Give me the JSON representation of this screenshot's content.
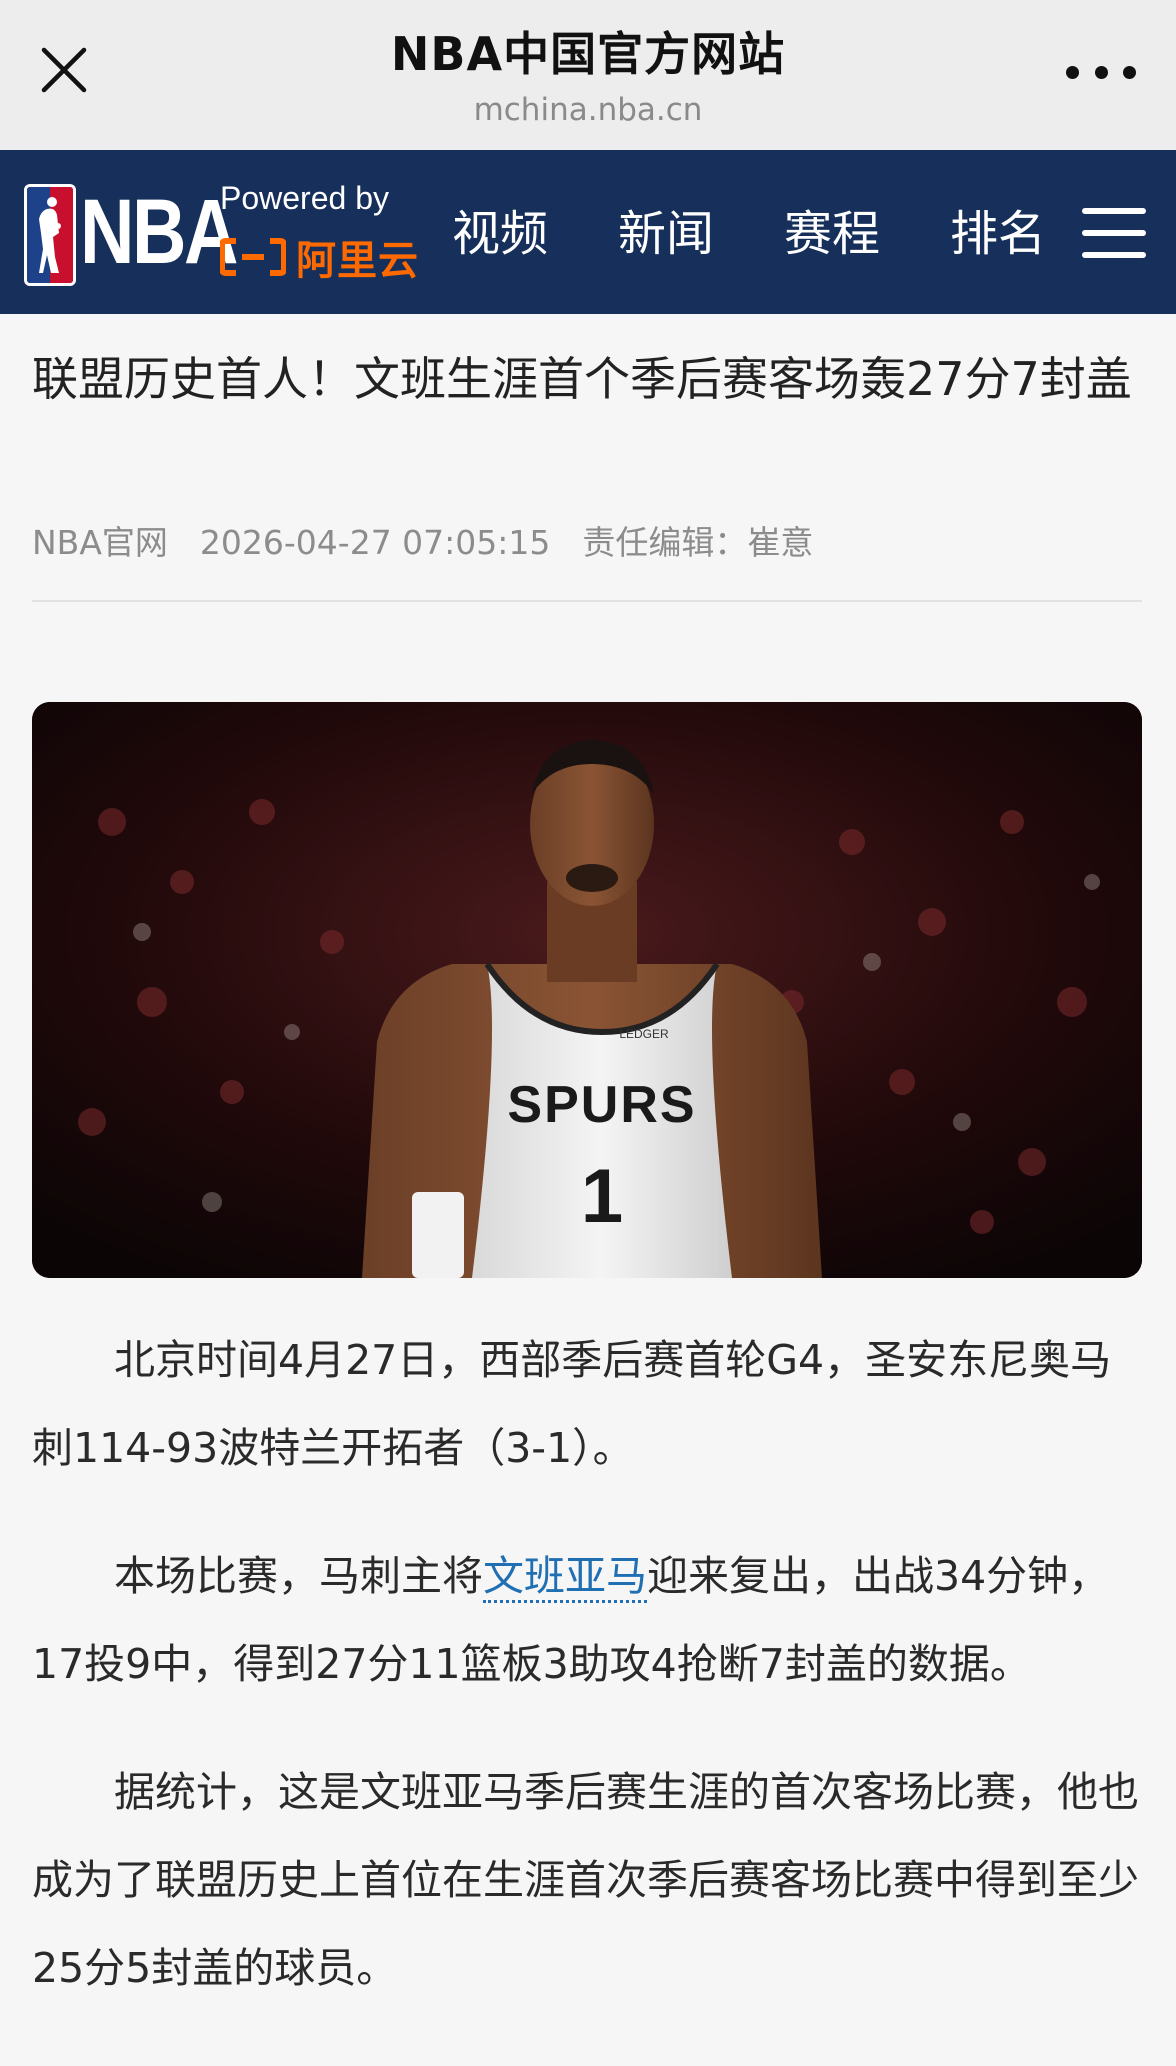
{
  "browser": {
    "title": "NBA中国官方网站",
    "url": "mchina.nba.cn",
    "close_icon": "close-icon",
    "more_icon": "more-icon"
  },
  "header": {
    "logo_text": "NBA",
    "powered_by": "Powered by",
    "sponsor": "阿里云",
    "nav": [
      "视频",
      "新闻",
      "赛程",
      "排名"
    ],
    "menu_icon": "hamburger-menu-icon",
    "colors": {
      "navy": "#17305b",
      "nba_blue": "#1d428a",
      "nba_red": "#c8102e",
      "aliyun_orange": "#ff6a00"
    }
  },
  "article": {
    "title": "联盟历史首人！文班生涯首个季后赛客场轰27分7封盖",
    "source": "NBA官网",
    "datetime": "2026-04-27 07:05:15",
    "editor": "责任编辑：崔意",
    "image": {
      "jersey_text": "SPURS",
      "jersey_number": "1",
      "sponsor_patch": "LEDGER"
    },
    "paragraphs": [
      {
        "text": "北京时间4月27日，西部季后赛首轮G4，圣安东尼奥马刺114-93波特兰开拓者（3-1）。"
      },
      {
        "before": "本场比赛，马刺主将",
        "link": "文班亚马",
        "after": "迎来复出，出战34分钟，17投9中，得到27分11篮板3助攻4抢断7封盖的数据。"
      },
      {
        "text": "据统计，这是文班亚马季后赛生涯的首次客场比赛，他也成为了联盟历史上首位在生涯首次季后赛客场比赛中得到至少25分5封盖的球员。"
      }
    ],
    "link_color": "#1f6fb2"
  }
}
